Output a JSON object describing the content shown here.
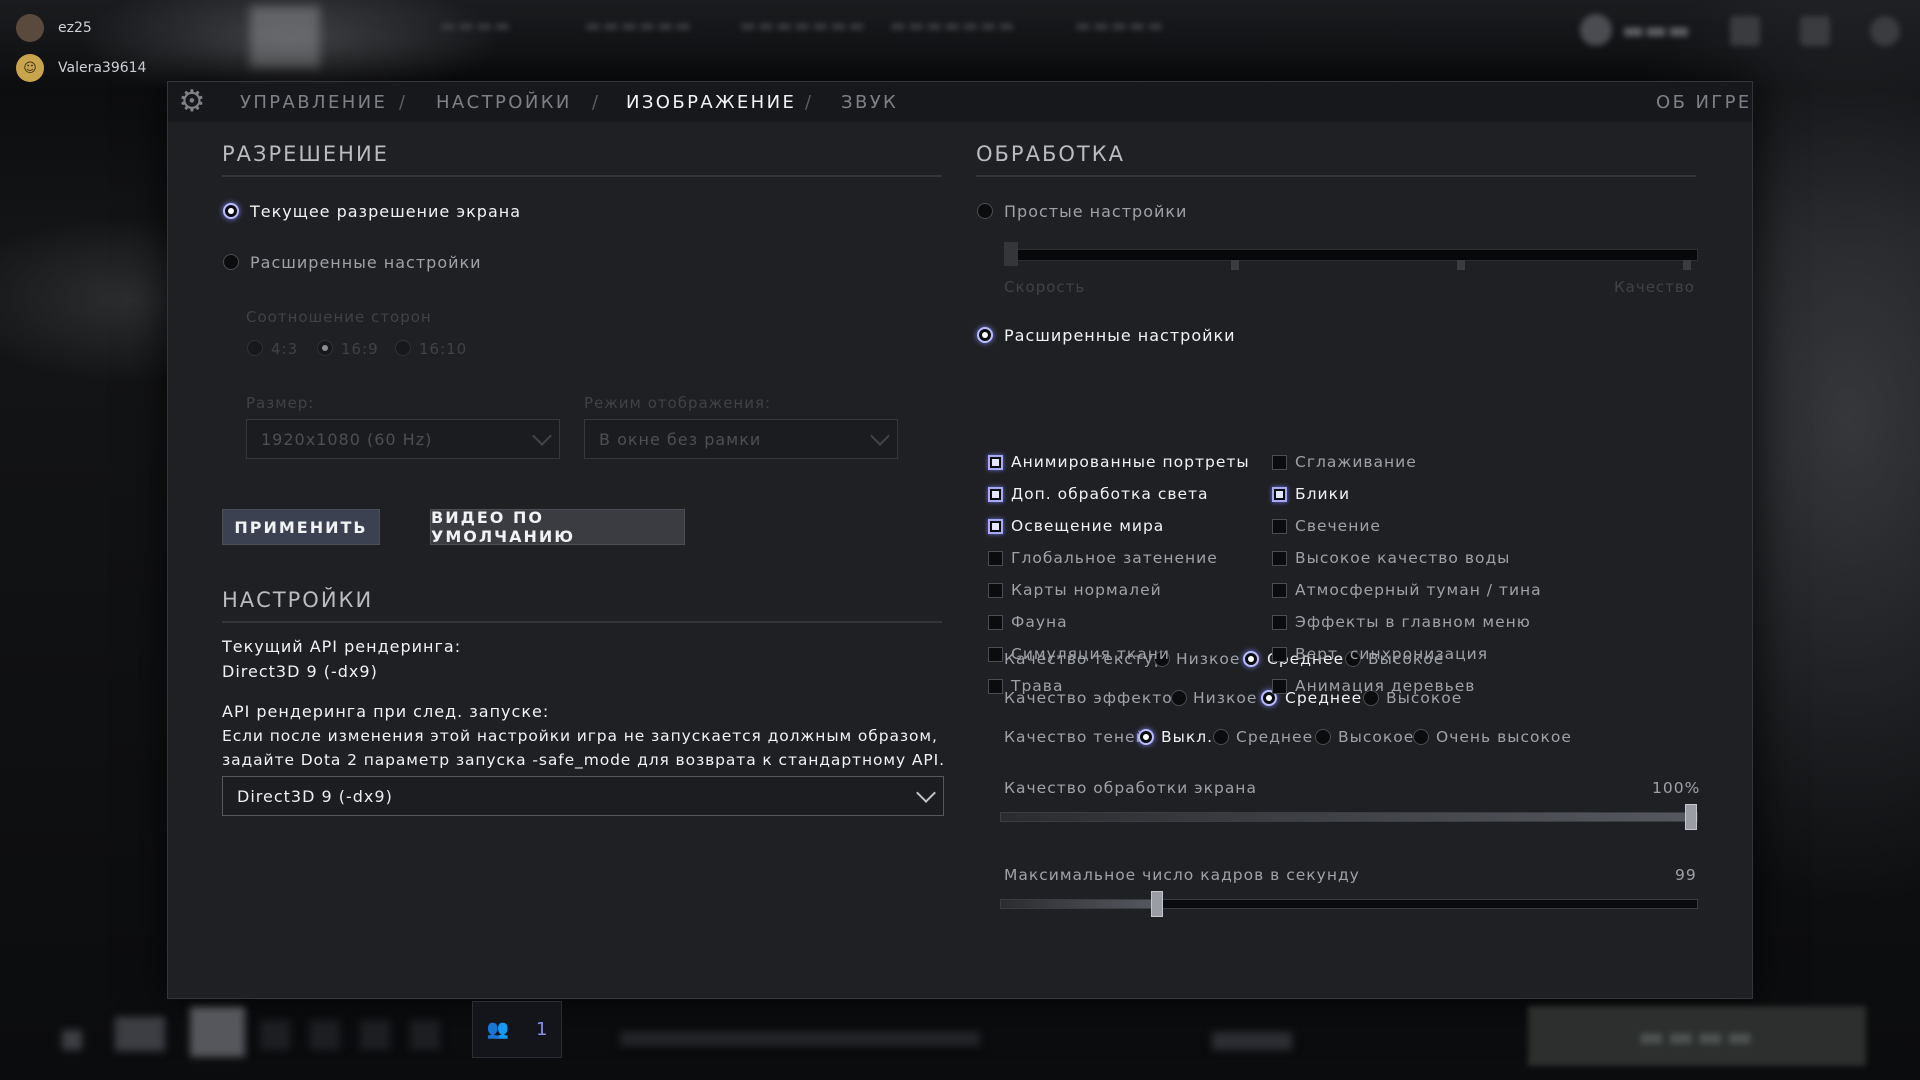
{
  "friends": [
    {
      "name": "ez25"
    },
    {
      "name": "Valera39614"
    }
  ],
  "tabs": [
    {
      "label": "УПРАВЛЕНИЕ"
    },
    {
      "label": "НАСТРОЙКИ"
    },
    {
      "label": "ИЗОБРАЖЕНИЕ"
    },
    {
      "label": "ЗВУК"
    }
  ],
  "tab_separator": "/",
  "about_label": "ОБ ИГРЕ",
  "resolution": {
    "title": "РАЗРЕШЕНИЕ",
    "current_label": "Текущее разрешение экрана",
    "advanced_label": "Расширенные настройки",
    "aspect_label": "Соотношение сторон",
    "aspects": [
      "4:3",
      "16:9",
      "16:10"
    ],
    "size_label": "Размер:",
    "size_value": "1920x1080 (60 Hz)",
    "mode_label": "Режим отображения:",
    "mode_value": "В окне без рамки",
    "apply_label": "ПРИМЕНИТЬ",
    "default_label": "ВИДЕО ПО УМОЛЧАНИЮ"
  },
  "settings": {
    "title": "НАСТРОЙКИ",
    "api_current_label": "Текущий API рендеринга:",
    "api_current_value": "Direct3D 9 (-dx9)",
    "api_next_label": "API рендеринга при след. запуске:",
    "api_note_line1": "Если после изменения этой настройки игра не запускается должным образом,",
    "api_note_line2": "задайте Dota 2 параметр запуска -safe_mode для возврата к стандартному API.",
    "api_select_value": "Direct3D 9 (-dx9)"
  },
  "processing": {
    "title": "ОБРАБОТКА",
    "simple_label": "Простые настройки",
    "speed_label": "Скорость",
    "quality_label": "Качество",
    "advanced_label": "Расширенные настройки",
    "left_checks": [
      {
        "label": "Анимированные портреты",
        "checked": true
      },
      {
        "label": "Доп. обработка света",
        "checked": true
      },
      {
        "label": "Освещение мира",
        "checked": true
      },
      {
        "label": "Глобальное затенение",
        "checked": false
      },
      {
        "label": "Карты нормалей",
        "checked": false
      },
      {
        "label": "Фауна",
        "checked": false
      },
      {
        "label": "Симуляция ткани",
        "checked": false
      },
      {
        "label": "Трава",
        "checked": false
      }
    ],
    "right_checks": [
      {
        "label": "Сглаживание",
        "checked": false
      },
      {
        "label": "Блики",
        "checked": true
      },
      {
        "label": "Свечение",
        "checked": false
      },
      {
        "label": "Высокое качество воды",
        "checked": false
      },
      {
        "label": "Атмосферный туман / тина",
        "checked": false
      },
      {
        "label": "Эффекты в главном меню",
        "checked": false
      },
      {
        "label": "Верт. синхронизация",
        "checked": false
      },
      {
        "label": "Анимация деревьев",
        "checked": false
      }
    ],
    "texture": {
      "label": "Качество текстур",
      "options": [
        "Низкое",
        "Среднее",
        "Высокое"
      ],
      "selected": "Среднее"
    },
    "effects": {
      "label": "Качество эффектов",
      "options": [
        "Низкое",
        "Среднее",
        "Высокое"
      ],
      "selected": "Среднее"
    },
    "shadows": {
      "label": "Качество теней",
      "options": [
        "Выкл.",
        "Среднее",
        "Высокое",
        "Очень высокое"
      ],
      "selected": "Выкл."
    },
    "screen_quality": {
      "label": "Качество обработки экрана",
      "value_text": "100%",
      "fraction": 1.0
    },
    "max_fps": {
      "label": "Максимальное число кадров в секунду",
      "value_text": "99",
      "fraction": 0.22
    }
  },
  "party_count": "1",
  "colors": {
    "accent": "#a6aaf5",
    "panel": "#1f2024"
  }
}
